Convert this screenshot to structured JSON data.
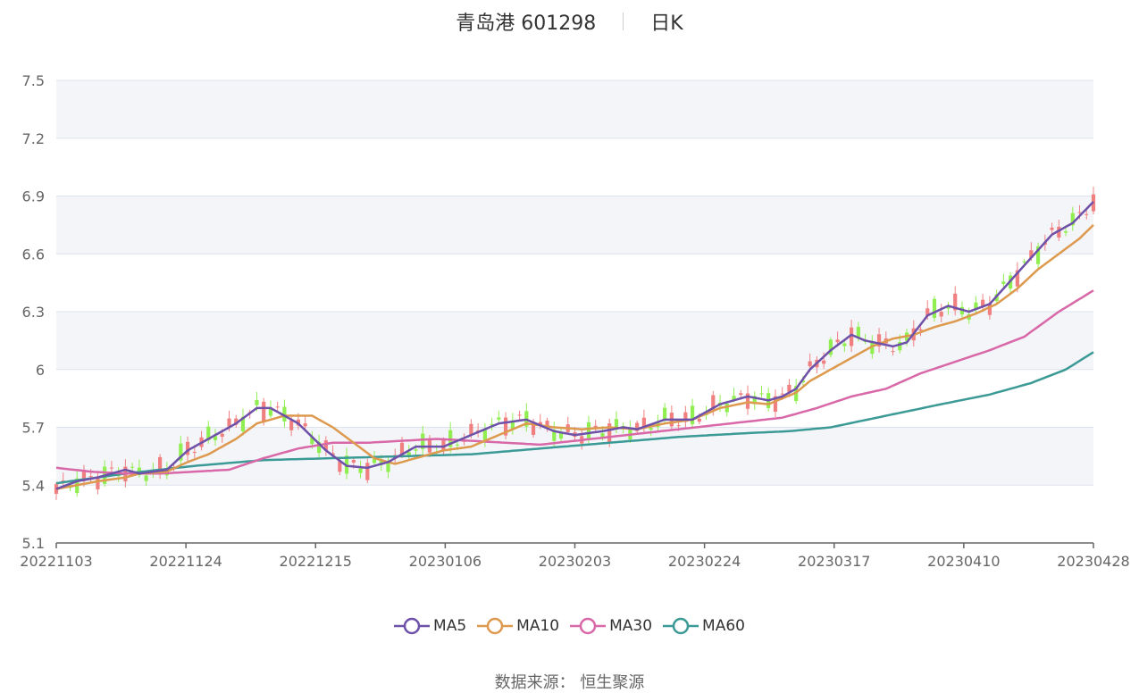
{
  "title": {
    "name": "青岛港 601298",
    "period": "日K"
  },
  "footer": "数据来源： 恒生聚源",
  "colors": {
    "up": "#f08080",
    "down": "#90ee50",
    "ma5": "#6e51a8",
    "ma10": "#dd9a4f",
    "ma30": "#d868a8",
    "ma60": "#3c9a96",
    "band": "#f4f5f9",
    "grid": "#dde3ee"
  },
  "chart_data": {
    "type": "candlestick",
    "yticks": [
      "7.5",
      "7.2",
      "6.9",
      "6.6",
      "6.3",
      "6",
      "5.7",
      "5.4",
      "5.1"
    ],
    "ylim": [
      5.1,
      7.5
    ],
    "xticks": [
      "20221103",
      "20221124",
      "20221215",
      "20230106",
      "20230203",
      "20230224",
      "20230317",
      "20230410",
      "20230428"
    ],
    "legend": [
      "MA5",
      "MA10",
      "MA30",
      "MA60"
    ],
    "ma5_anchors": [
      [
        0,
        5.38
      ],
      [
        6,
        5.42
      ],
      [
        12,
        5.44
      ],
      [
        20,
        5.48
      ],
      [
        24,
        5.46
      ],
      [
        32,
        5.48
      ],
      [
        38,
        5.58
      ],
      [
        44,
        5.64
      ],
      [
        52,
        5.72
      ],
      [
        58,
        5.8
      ],
      [
        62,
        5.8
      ],
      [
        70,
        5.72
      ],
      [
        78,
        5.58
      ],
      [
        84,
        5.5
      ],
      [
        90,
        5.49
      ],
      [
        96,
        5.52
      ],
      [
        104,
        5.6
      ],
      [
        112,
        5.6
      ],
      [
        120,
        5.66
      ],
      [
        128,
        5.72
      ],
      [
        136,
        5.74
      ],
      [
        144,
        5.68
      ],
      [
        150,
        5.66
      ],
      [
        158,
        5.68
      ],
      [
        164,
        5.7
      ],
      [
        168,
        5.69
      ],
      [
        176,
        5.74
      ],
      [
        184,
        5.74
      ],
      [
        192,
        5.82
      ],
      [
        200,
        5.86
      ],
      [
        206,
        5.84
      ],
      [
        210,
        5.86
      ],
      [
        214,
        5.9
      ],
      [
        218,
        6.0
      ],
      [
        224,
        6.1
      ],
      [
        230,
        6.18
      ],
      [
        234,
        6.15
      ],
      [
        242,
        6.12
      ],
      [
        246,
        6.14
      ],
      [
        252,
        6.28
      ],
      [
        258,
        6.33
      ],
      [
        264,
        6.3
      ],
      [
        270,
        6.34
      ],
      [
        276,
        6.46
      ],
      [
        282,
        6.58
      ],
      [
        288,
        6.7
      ],
      [
        294,
        6.76
      ],
      [
        300,
        6.87
      ]
    ],
    "ma10_anchors": [
      [
        0,
        5.38
      ],
      [
        6,
        5.4
      ],
      [
        12,
        5.42
      ],
      [
        20,
        5.44
      ],
      [
        24,
        5.46
      ],
      [
        32,
        5.47
      ],
      [
        38,
        5.52
      ],
      [
        44,
        5.56
      ],
      [
        52,
        5.64
      ],
      [
        58,
        5.72
      ],
      [
        66,
        5.76
      ],
      [
        74,
        5.76
      ],
      [
        80,
        5.7
      ],
      [
        86,
        5.62
      ],
      [
        92,
        5.54
      ],
      [
        98,
        5.51
      ],
      [
        104,
        5.54
      ],
      [
        112,
        5.58
      ],
      [
        120,
        5.6
      ],
      [
        128,
        5.66
      ],
      [
        136,
        5.72
      ],
      [
        144,
        5.7
      ],
      [
        152,
        5.69
      ],
      [
        160,
        5.7
      ],
      [
        168,
        5.69
      ],
      [
        176,
        5.72
      ],
      [
        184,
        5.74
      ],
      [
        192,
        5.8
      ],
      [
        200,
        5.83
      ],
      [
        206,
        5.82
      ],
      [
        210,
        5.85
      ],
      [
        214,
        5.88
      ],
      [
        218,
        5.94
      ],
      [
        224,
        6.0
      ],
      [
        230,
        6.06
      ],
      [
        236,
        6.12
      ],
      [
        242,
        6.16
      ],
      [
        248,
        6.18
      ],
      [
        254,
        6.22
      ],
      [
        260,
        6.25
      ],
      [
        266,
        6.29
      ],
      [
        272,
        6.34
      ],
      [
        278,
        6.42
      ],
      [
        284,
        6.52
      ],
      [
        290,
        6.6
      ],
      [
        296,
        6.68
      ],
      [
        300,
        6.75
      ]
    ],
    "ma30_anchors": [
      [
        0,
        5.49
      ],
      [
        10,
        5.47
      ],
      [
        20,
        5.46
      ],
      [
        30,
        5.46
      ],
      [
        40,
        5.47
      ],
      [
        50,
        5.48
      ],
      [
        60,
        5.54
      ],
      [
        70,
        5.59
      ],
      [
        80,
        5.62
      ],
      [
        90,
        5.62
      ],
      [
        100,
        5.63
      ],
      [
        110,
        5.64
      ],
      [
        120,
        5.63
      ],
      [
        130,
        5.62
      ],
      [
        140,
        5.61
      ],
      [
        150,
        5.63
      ],
      [
        160,
        5.65
      ],
      [
        170,
        5.67
      ],
      [
        180,
        5.69
      ],
      [
        190,
        5.71
      ],
      [
        200,
        5.73
      ],
      [
        210,
        5.75
      ],
      [
        220,
        5.8
      ],
      [
        230,
        5.86
      ],
      [
        240,
        5.9
      ],
      [
        250,
        5.98
      ],
      [
        260,
        6.04
      ],
      [
        270,
        6.1
      ],
      [
        280,
        6.17
      ],
      [
        290,
        6.3
      ],
      [
        300,
        6.41
      ]
    ],
    "ma60_anchors": [
      [
        0,
        5.41
      ],
      [
        20,
        5.46
      ],
      [
        40,
        5.5
      ],
      [
        60,
        5.53
      ],
      [
        80,
        5.54
      ],
      [
        100,
        5.55
      ],
      [
        120,
        5.56
      ],
      [
        140,
        5.59
      ],
      [
        160,
        5.62
      ],
      [
        180,
        5.65
      ],
      [
        200,
        5.67
      ],
      [
        212,
        5.68
      ],
      [
        224,
        5.7
      ],
      [
        240,
        5.76
      ],
      [
        256,
        5.82
      ],
      [
        270,
        5.87
      ],
      [
        282,
        5.93
      ],
      [
        292,
        6.0
      ],
      [
        300,
        6.09
      ]
    ]
  }
}
